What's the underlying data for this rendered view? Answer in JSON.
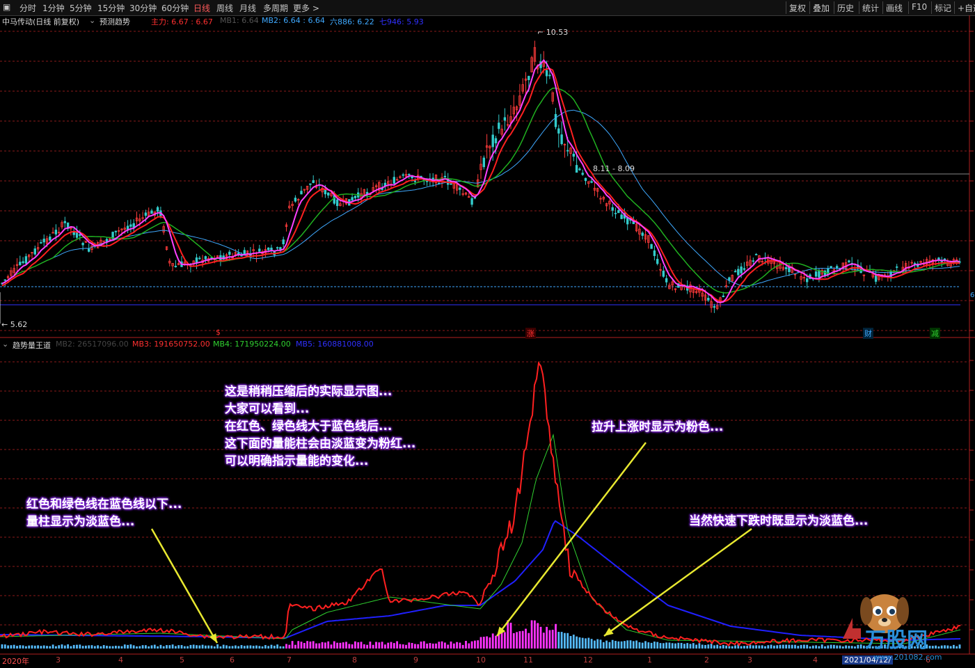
{
  "toolbar": {
    "periods": [
      "分时",
      "1分钟",
      "5分钟",
      "15分钟",
      "30分钟",
      "60分钟",
      "日线",
      "周线",
      "月线",
      "多周期",
      "更多 >"
    ],
    "active_period": "日线",
    "right_items": [
      "复权",
      "叠加",
      "历史",
      "统计",
      "画线",
      "F10",
      "标记",
      "+自选"
    ]
  },
  "main_legend": {
    "stock": "中马传动(日线 前复权)",
    "indicator": "预测趋势",
    "items": [
      {
        "label": "主力",
        "value": "6.67 : 6.67",
        "color": "#ff3030"
      },
      {
        "label": "MB1",
        "value": "6.64",
        "color": "#555555"
      },
      {
        "label": "MB2",
        "value": "6.64 : 6.64",
        "color": "#3fa9ff"
      },
      {
        "label": "六886",
        "value": "6.22",
        "color": "#3fa9ff"
      },
      {
        "label": "七946",
        "value": "5.93",
        "color": "#3030ff"
      }
    ]
  },
  "sub_legend": {
    "indicator": "趋势量王道",
    "items": [
      {
        "label": "MB2",
        "value": "26517096.00",
        "color": "#444444"
      },
      {
        "label": "MB3",
        "value": "191650752.00",
        "color": "#ff3030"
      },
      {
        "label": "MB4",
        "value": "171950224.00",
        "color": "#30d030"
      },
      {
        "label": "MB5",
        "value": "160881008.00",
        "color": "#3030ff"
      }
    ]
  },
  "price_labels": {
    "high": "10.53",
    "low": "5.62",
    "mid": "8.11 - 8.09",
    "right_edge": "6"
  },
  "events": [
    {
      "label": "$",
      "color": "#ff3030"
    },
    {
      "label": "涨",
      "color": "#ff3030"
    },
    {
      "label": "财",
      "color": "#3fa9ff"
    },
    {
      "label": "减",
      "color": "#30d030"
    }
  ],
  "x_axis": {
    "labels": [
      "2020年",
      "3",
      "4",
      "5",
      "6",
      "7",
      "8",
      "9",
      "10",
      "11",
      "12",
      "1",
      "2",
      "3",
      "4",
      "2021/04/12/",
      "6"
    ]
  },
  "annotations": {
    "note1": [
      "这是稍稍压缩后的实际显示图...",
      "大家可以看到...",
      "在红色、绿色线大于蓝色线后...",
      "这下面的量能柱会由淡蓝变为粉红...",
      "可以明确指示量能的变化..."
    ],
    "note2": [
      "红色和绿色线在蓝色线以下...",
      "量柱显示为淡蓝色..."
    ],
    "note3": [
      "拉升上涨时显示为粉色..."
    ],
    "note4": [
      "当然快速下跌时既显示为淡蓝色..."
    ]
  },
  "logo": {
    "brand": "万股网",
    "url": "www.201082.com"
  },
  "colors": {
    "up": "#ff3b3b",
    "down": "#33cccc",
    "ma_pink": "#ff40ff",
    "ma_red": "#ff2020",
    "ma_green": "#20b020",
    "ma_blue": "#3fa9ff",
    "vol_pink": "#ff33ff",
    "vol_blue": "#55bbff",
    "vol_red_line": "#ff2020",
    "vol_green_line": "#30d030",
    "vol_blue_line": "#2020ff",
    "grid": "#8b1a1a"
  },
  "chart_data": [
    {
      "type": "line",
      "title": "中马传动(日线 前复权)",
      "series_kind": "candlestick",
      "x": [
        "2020-02",
        "2020-03",
        "2020-04",
        "2020-05",
        "2020-06",
        "2020-07",
        "2020-08",
        "2020-09",
        "2020-10",
        "2020-11",
        "2020-12",
        "2021-01",
        "2021-02",
        "2021-03",
        "2021-04",
        "2021-05",
        "2021-06"
      ],
      "close": [
        6.1,
        7.1,
        6.8,
        6.6,
        6.5,
        8.2,
        8.0,
        8.2,
        8.1,
        9.6,
        8.1,
        6.2,
        5.9,
        6.4,
        6.5,
        6.6,
        6.67
      ],
      "ylim": [
        5.4,
        10.9
      ],
      "annotations": {
        "high": 10.53,
        "low": 5.62,
        "level": 8.1
      }
    },
    {
      "type": "bar",
      "title": "趋势量王道",
      "x": [
        "2020-02",
        "2020-03",
        "2020-04",
        "2020-05",
        "2020-06",
        "2020-07",
        "2020-08",
        "2020-09",
        "2020-10",
        "2020-11",
        "2020-12",
        "2021-01",
        "2021-02",
        "2021-03",
        "2021-04",
        "2021-05",
        "2021-06"
      ],
      "series": [
        {
          "name": "MB3",
          "values": [
            0.6,
            0.9,
            1.0,
            0.8,
            0.7,
            2.3,
            3.0,
            2.4,
            3.5,
            9.5,
            2.2,
            0.4,
            0.3,
            0.5,
            0.6,
            0.7,
            1.9
          ]
        },
        {
          "name": "MB4",
          "values": [
            0.6,
            0.8,
            0.9,
            0.8,
            0.7,
            1.8,
            2.4,
            2.3,
            2.6,
            6.4,
            2.6,
            0.6,
            0.3,
            0.4,
            0.5,
            0.6,
            1.7
          ]
        },
        {
          "name": "MB5",
          "values": [
            0.7,
            0.75,
            0.8,
            0.8,
            0.75,
            1.1,
            1.7,
            2.0,
            2.3,
            4.6,
            3.6,
            1.6,
            0.9,
            0.7,
            0.6,
            0.6,
            1.6
          ]
        }
      ],
      "ylim": [
        0,
        11
      ],
      "ylabel": ""
    }
  ]
}
